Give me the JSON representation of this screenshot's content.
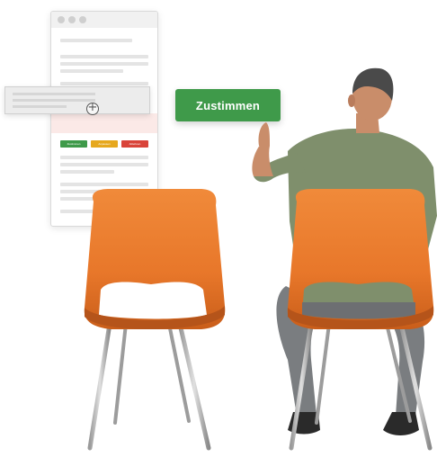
{
  "cta": {
    "label": "Zustimmen",
    "color": "#3f9a4a"
  },
  "mockup": {
    "buttons": [
      {
        "label": "Zustimmen",
        "color": "#3f9a4a"
      },
      {
        "label": "Anpassen",
        "color": "#e6a81e"
      },
      {
        "label": "Ablehnen",
        "color": "#d9443a"
      }
    ]
  },
  "icons": {
    "add": "plus-circle-icon"
  },
  "colors": {
    "chair": "#e8772a",
    "shirt": "#7f8f6c",
    "trousers": "#7a7d80"
  }
}
